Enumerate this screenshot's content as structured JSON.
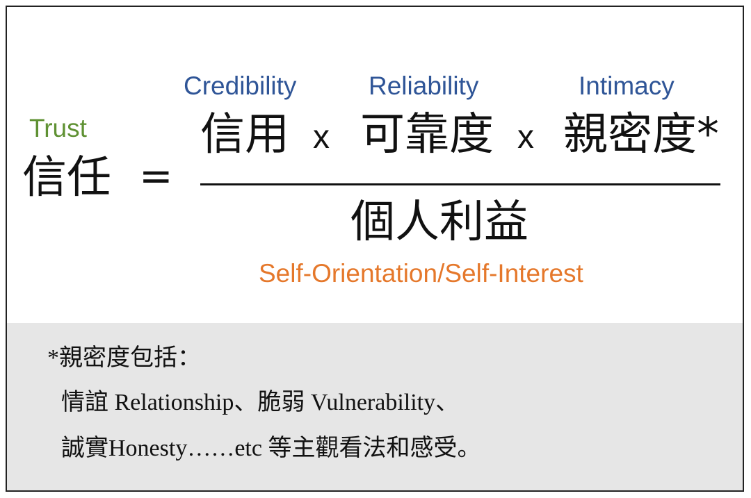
{
  "formula": {
    "lhs": {
      "en": "Trust",
      "zh": "信任"
    },
    "equals": "=",
    "operator": "x",
    "numerator": [
      {
        "en": "Credibility",
        "zh": "信用"
      },
      {
        "en": "Reliability",
        "zh": "可靠度"
      },
      {
        "en": "Intimacy",
        "zh": "親密度*"
      }
    ],
    "denominator": {
      "zh": "個人利益",
      "en": "Self-Orientation/Self-Interest"
    }
  },
  "note": {
    "line1": "*親密度包括：",
    "line2": "情誼 Relationship、脆弱 Vulnerability、",
    "line3": "誠實Honesty……etc 等主觀看法和感受。"
  },
  "colors": {
    "blue_label": "#2f5597",
    "green_label": "#5f9133",
    "orange_label": "#e5782b",
    "note_background": "#e6e6e6",
    "border": "#222222"
  }
}
